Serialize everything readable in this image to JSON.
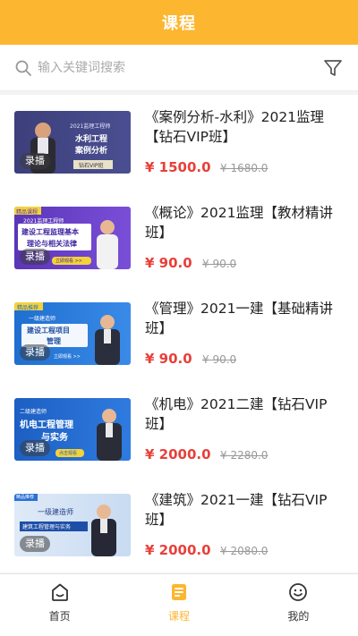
{
  "header": {
    "title": "课程"
  },
  "search": {
    "placeholder": "输入关键词搜索"
  },
  "courses": [
    {
      "title": "《案例分析-水利》2021监理【钻石VIP班】",
      "price": "¥ 1500.0",
      "original_price": "¥ 1680.0",
      "badge": "录播",
      "thumb_lines": [
        "2021监理工程师",
        "水利工程",
        "案例分析",
        "钻石VIP班"
      ]
    },
    {
      "title": "《概论》2021监理【教材精讲班】",
      "price": "¥ 90.0",
      "original_price": "¥ 90.0",
      "badge": "录播",
      "thumb_lines": [
        "精品课程",
        "2021监理工程师",
        "建设工程监理基本",
        "理论与相关法律",
        "立即观看 >>"
      ]
    },
    {
      "title": "《管理》2021一建【基础精讲班】",
      "price": "¥ 90.0",
      "original_price": "¥ 90.0",
      "badge": "录播",
      "thumb_lines": [
        "精品推荐",
        "一级建造师",
        "建设工程项目",
        "管理",
        "立即观看 >>"
      ]
    },
    {
      "title": "《机电》2021二建【钻石VIP班】",
      "price": "¥ 2000.0",
      "original_price": "¥ 2280.0",
      "badge": "录播",
      "thumb_lines": [
        "二级建造师",
        "机电工程管理",
        "与实务",
        "点击观看"
      ]
    },
    {
      "title": "《建筑》2021一建【钻石VIP班】",
      "price": "¥ 2000.0",
      "original_price": "¥ 2080.0",
      "badge": "录播",
      "thumb_lines": [
        "精品推荐",
        "一级建造师",
        "建筑工程管理与实务"
      ]
    }
  ],
  "tabbar": {
    "items": [
      {
        "label": "首页"
      },
      {
        "label": "课程"
      },
      {
        "label": "我的"
      }
    ]
  },
  "colors": {
    "accent": "#fcb630",
    "price": "#e8403a"
  }
}
